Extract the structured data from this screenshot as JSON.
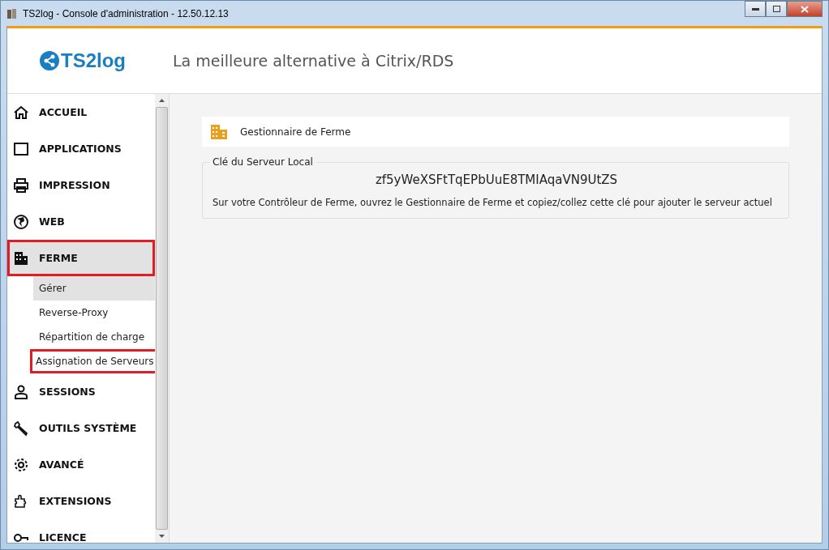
{
  "window": {
    "title": "TS2log - Console d'administration - 12.50.12.13"
  },
  "header": {
    "logo": "TS2log",
    "tagline": "La meilleure alternative à Citrix/RDS"
  },
  "sidebar": {
    "items": [
      {
        "label": "ACCUEIL",
        "selected": false,
        "highlighted": false
      },
      {
        "label": "APPLICATIONS",
        "selected": false,
        "highlighted": false
      },
      {
        "label": "IMPRESSION",
        "selected": false,
        "highlighted": false
      },
      {
        "label": "WEB",
        "selected": false,
        "highlighted": false
      },
      {
        "label": "FERME",
        "selected": true,
        "highlighted": true,
        "expanded": true,
        "children": [
          {
            "label": "Gérer",
            "selected": true,
            "highlighted": false
          },
          {
            "label": "Reverse-Proxy",
            "selected": false,
            "highlighted": false
          },
          {
            "label": "Répartition de charge",
            "selected": false,
            "highlighted": false
          },
          {
            "label": "Assignation de Serveurs",
            "selected": false,
            "highlighted": true
          }
        ]
      },
      {
        "label": "SESSIONS",
        "selected": false,
        "highlighted": false
      },
      {
        "label": "OUTILS SYSTÈME",
        "selected": false,
        "highlighted": false
      },
      {
        "label": "AVANCÉ",
        "selected": false,
        "highlighted": false
      },
      {
        "label": "EXTENSIONS",
        "selected": false,
        "highlighted": false
      },
      {
        "label": "LICENCE",
        "selected": false,
        "highlighted": false
      }
    ]
  },
  "main": {
    "title": "Gestionnaire de Ferme",
    "key_group": {
      "legend": "Clé du Serveur Local",
      "key": "zf5yWeXSFtTqEPbUuE8TMIAqaVN9UtZS",
      "instructions": "Sur votre Contrôleur de Ferme, ouvrez le Gestionnaire de Ferme et copiez/collez cette clé pour ajouter le serveur actuel"
    }
  }
}
